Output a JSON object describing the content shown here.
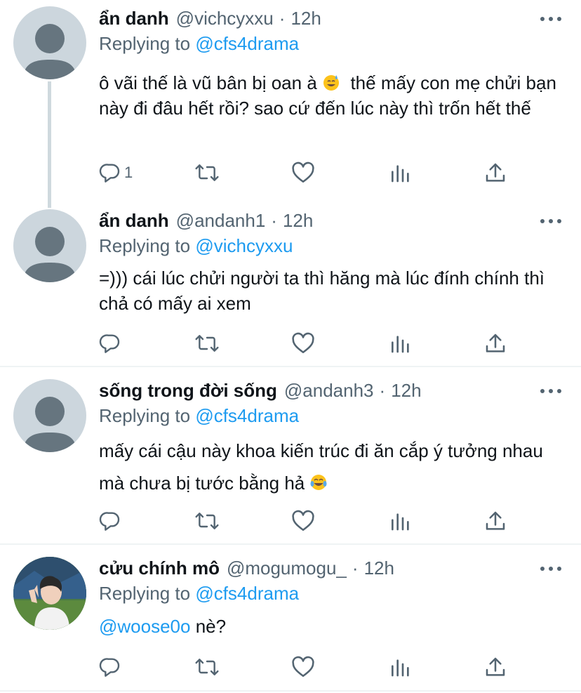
{
  "colors": {
    "link": "#1d9bf0",
    "secondary_text": "#536471",
    "primary_text": "#0f1419",
    "avatar_placeholder": "#ccd6dd",
    "divider": "#eff3f4"
  },
  "tweets": [
    {
      "name": "ẩn danh",
      "handle": "@vichcyxxu",
      "dot": "·",
      "time": "12h",
      "replying_prefix": "Replying to ",
      "replying_to": "@cfs4drama",
      "text": "ô vãi thế là vũ bân bị oan à ",
      "text_after_emoji": "  thế mấy con mẹ chửi bạn này đi đâu hết rồi? sao cứ đến lúc này thì trốn hết thế",
      "emoji": "grinning-sweat-emoji",
      "reply_count": "1",
      "icons": [
        "reply-icon",
        "retweet-icon",
        "like-icon",
        "analytics-icon",
        "share-icon"
      ]
    },
    {
      "name": "ẩn danh",
      "handle": "@andanh1",
      "dot": "·",
      "time": "12h",
      "replying_prefix": "Replying to ",
      "replying_to": "@vichcyxxu",
      "text": "=))) cái lúc chửi người ta thì hăng mà lúc đính chính thì chả có mấy ai xem",
      "icons": [
        "reply-icon",
        "retweet-icon",
        "like-icon",
        "analytics-icon",
        "share-icon"
      ]
    },
    {
      "name": "sống trong đời sống",
      "handle": "@andanh3",
      "dot": "·",
      "time": "12h",
      "replying_prefix": "Replying to ",
      "replying_to": "@cfs4drama",
      "text": "mấy cái cậu này khoa kiến trúc đi ăn cắp ý tưởng nhau mà chưa bị tước bằng hả ",
      "emoji": "tears-of-joy-emoji",
      "icons": [
        "reply-icon",
        "retweet-icon",
        "like-icon",
        "analytics-icon",
        "share-icon"
      ]
    },
    {
      "name": "cửu chính mô",
      "handle": "@mogumogu_",
      "dot": "·",
      "time": "12h",
      "replying_prefix": "Replying to ",
      "replying_to": "@cfs4drama",
      "mention": "@woose0o",
      "text": " nè?",
      "icons": [
        "reply-icon",
        "retweet-icon",
        "like-icon",
        "analytics-icon",
        "share-icon"
      ]
    }
  ]
}
